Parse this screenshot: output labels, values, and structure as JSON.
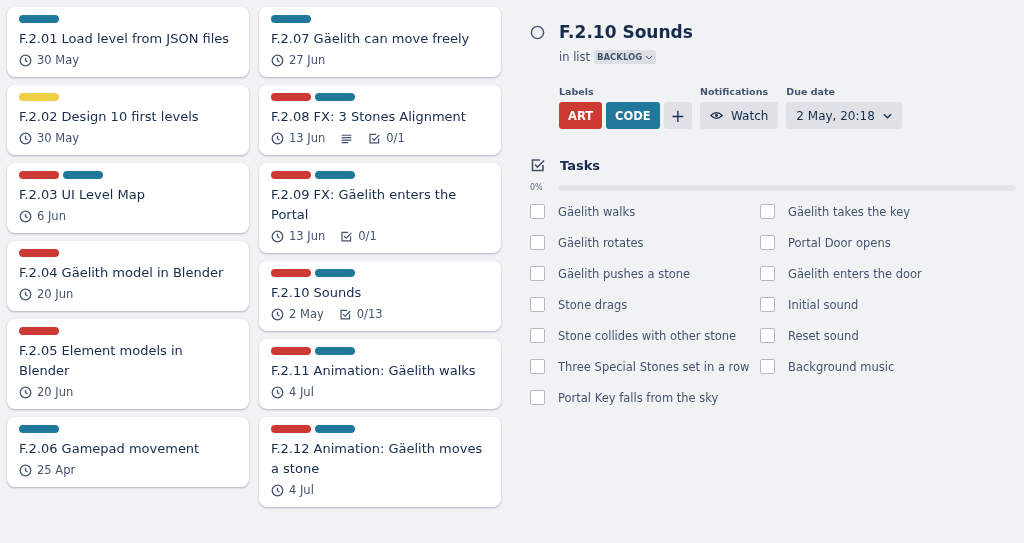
{
  "columns": [
    {
      "cards": [
        {
          "labels": [
            {
              "color": "#21789a"
            }
          ],
          "title": "F.2.01 Load level from JSON files",
          "due": "30 May"
        },
        {
          "labels": [
            {
              "color": "#f2cd4a"
            }
          ],
          "title": "F.2.02 Design 10 first levels",
          "due": "30 May"
        },
        {
          "labels": [
            {
              "color": "#cc3a33"
            },
            {
              "color": "#21789a"
            }
          ],
          "title": "F.2.03 UI Level Map",
          "due": "6 Jun"
        },
        {
          "labels": [
            {
              "color": "#cc3a33"
            }
          ],
          "title": "F.2.04 Gäelith model in Blender",
          "due": "20 Jun"
        },
        {
          "labels": [
            {
              "color": "#cc3a33"
            }
          ],
          "title": "F.2.05 Element models in Blender",
          "due": "20 Jun"
        },
        {
          "labels": [
            {
              "color": "#21789a"
            }
          ],
          "title": "F.2.06 Gamepad movement",
          "due": "25 Apr"
        }
      ]
    },
    {
      "cards": [
        {
          "labels": [
            {
              "color": "#21789a"
            }
          ],
          "title": "F.2.07 Gäelith can move freely",
          "due": "27 Jun"
        },
        {
          "labels": [
            {
              "color": "#cc3a33"
            },
            {
              "color": "#21789a"
            }
          ],
          "title": "F.2.08 FX: 3 Stones Alignment",
          "due": "13 Jun",
          "has_description": true,
          "checklist": "0/1"
        },
        {
          "labels": [
            {
              "color": "#cc3a33"
            },
            {
              "color": "#21789a"
            }
          ],
          "title": "F.2.09 FX: Gäelith enters the Portal",
          "due": "13 Jun",
          "checklist": "0/1"
        },
        {
          "labels": [
            {
              "color": "#cc3a33"
            },
            {
              "color": "#21789a"
            }
          ],
          "title": "F.2.10 Sounds",
          "due": "2 May",
          "checklist": "0/13"
        },
        {
          "labels": [
            {
              "color": "#cc3a33"
            },
            {
              "color": "#21789a"
            }
          ],
          "title": "F.2.11 Animation: Gäelith walks",
          "due": "4 Jul"
        },
        {
          "labels": [
            {
              "color": "#cc3a33"
            },
            {
              "color": "#21789a"
            }
          ],
          "title": "F.2.12 Animation: Gäelith moves a stone",
          "due": "4 Jul"
        }
      ]
    }
  ],
  "detail": {
    "title": "F.2.10 Sounds",
    "list_prefix": "in list",
    "list_name": "BACKLOG",
    "labels_heading": "Labels",
    "labels": [
      {
        "text": "ART",
        "color": "#cc3a33"
      },
      {
        "text": "CODE",
        "color": "#21789a"
      }
    ],
    "add_label": "+",
    "notifications_heading": "Notifications",
    "watch": "Watch",
    "due_heading": "Due date",
    "due": "2 May, 20:18",
    "tasks_heading": "Tasks",
    "progress_text": "0%",
    "progress": {
      "level": 0
    },
    "tasks": [
      {
        "label": "Gäelith walks",
        "checked": false
      },
      {
        "label": "Gäelith rotates",
        "checked": false
      },
      {
        "label": "Gäelith pushes a stone",
        "checked": false
      },
      {
        "label": "Stone drags",
        "checked": false
      },
      {
        "label": "Stone collides with other stone",
        "checked": false
      },
      {
        "label": "Three Special Stones set in a row",
        "checked": false
      },
      {
        "label": "Portal Key falls from the sky",
        "checked": false
      },
      {
        "label": "Gäelith takes the key",
        "checked": false
      },
      {
        "label": "Portal Door opens",
        "checked": false
      },
      {
        "label": "Gäelith enters the door",
        "checked": false
      },
      {
        "label": "Initial sound",
        "checked": false
      },
      {
        "label": "Reset sound",
        "checked": false
      },
      {
        "label": "Background music",
        "checked": false
      }
    ]
  }
}
